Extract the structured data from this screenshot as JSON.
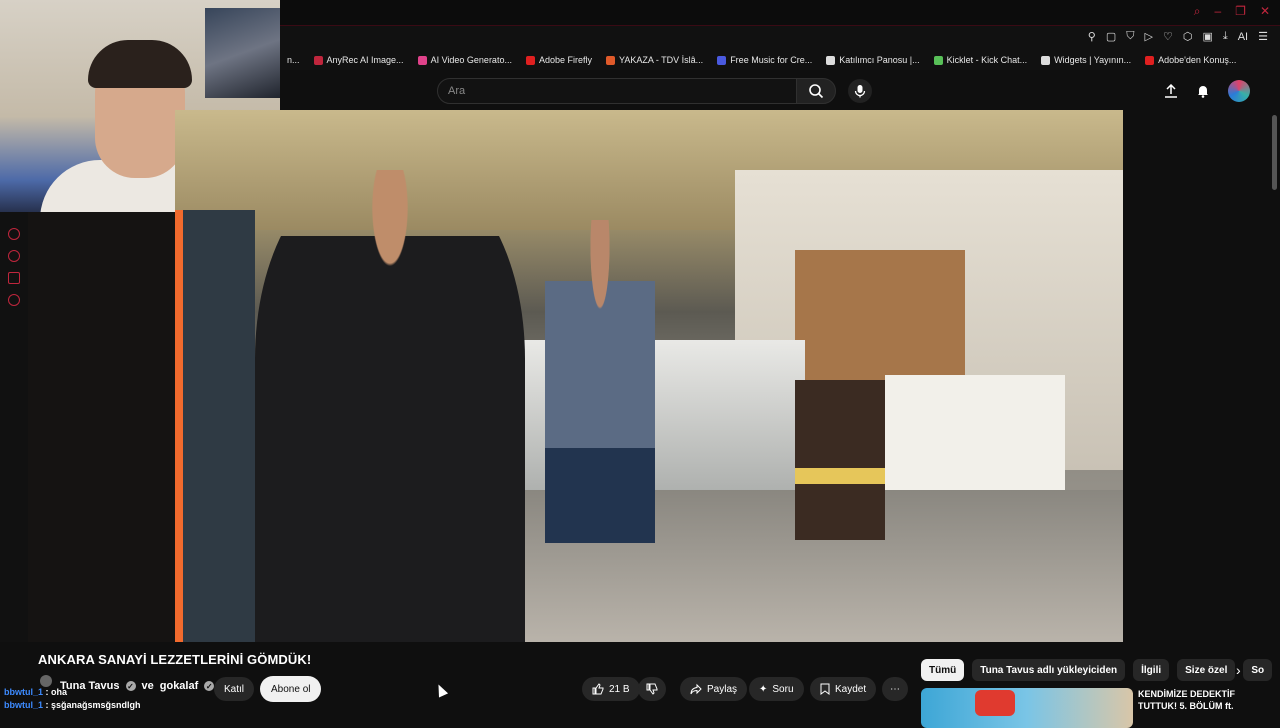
{
  "browser": {
    "bookmarks": [
      {
        "label": "AnyRec AI Image...",
        "color": "#c0263d"
      },
      {
        "label": "AI Video Generato...",
        "color": "#e0428a"
      },
      {
        "label": "Adobe Firefly",
        "color": "#e02020"
      },
      {
        "label": "YAKAZA - TDV İslâ...",
        "color": "#e05a2a"
      },
      {
        "label": "Free Music for Cre...",
        "color": "#4a5ae0"
      },
      {
        "label": "Katılımcı Panosu |...",
        "color": "#dddddd"
      },
      {
        "label": "Kicklet - Kick Chat...",
        "color": "#58c058"
      },
      {
        "label": "Widgets | Yayının...",
        "color": "#dddddd"
      },
      {
        "label": "Adobe'den Konuş...",
        "color": "#e02020"
      }
    ],
    "extension_ai_label": "AI"
  },
  "youtube": {
    "search": {
      "placeholder": "Ara"
    },
    "video": {
      "title": "ANKARA SANAYİ LEZZETLERİNİ GÖMDÜK!"
    },
    "channel": {
      "name": "Tuna Tavus",
      "connector": "ve",
      "collab": "gokalaf"
    },
    "actions": {
      "join": "Katıl",
      "subscribe": "Abone ol",
      "likes": "21 B",
      "share": "Paylaş",
      "ask": "Soru",
      "save": "Kaydet"
    },
    "chips": [
      "Tümü",
      "Tuna Tavus adlı yükleyiciden",
      "İlgili",
      "Size özel",
      "So"
    ],
    "recommendation": {
      "title": "KENDİMİZE DEDEKTİF TUTTUK! 5. BÖLÜM ft."
    }
  },
  "chat": [
    {
      "user": "bbwtul_1",
      "message": ": oha"
    },
    {
      "user": "bbwtul_1",
      "message": ": şsğanağsmsğsndlgh"
    }
  ],
  "colors": {
    "accent": "#c0263d",
    "chat_name": "#3d8bff",
    "bg": "#0f0f0f"
  }
}
